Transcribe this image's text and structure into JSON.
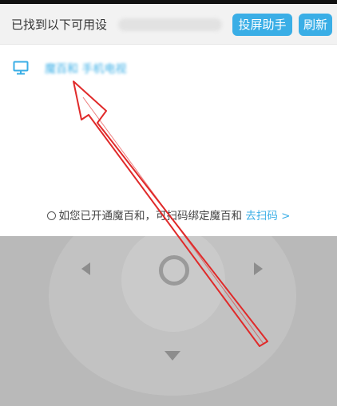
{
  "header": {
    "found_text": "已找到以下可用设",
    "cast_button_label": "投屏助手",
    "refresh_button_label": "刷新"
  },
  "device": {
    "icon": "tv-icon",
    "name": "魔百和 手机电视"
  },
  "hint": {
    "text": "如您已开通魔百和，可扫码绑定魔百和",
    "link_label": "去扫码 >"
  },
  "remote": {
    "controls": [
      "left-arrow-icon",
      "ok-button",
      "right-arrow-icon",
      "down-arrow-icon"
    ]
  },
  "colors": {
    "accent": "#3aaee6",
    "annotation_arrow": "#e02a2a",
    "remote_background": "#b9b9b9"
  }
}
